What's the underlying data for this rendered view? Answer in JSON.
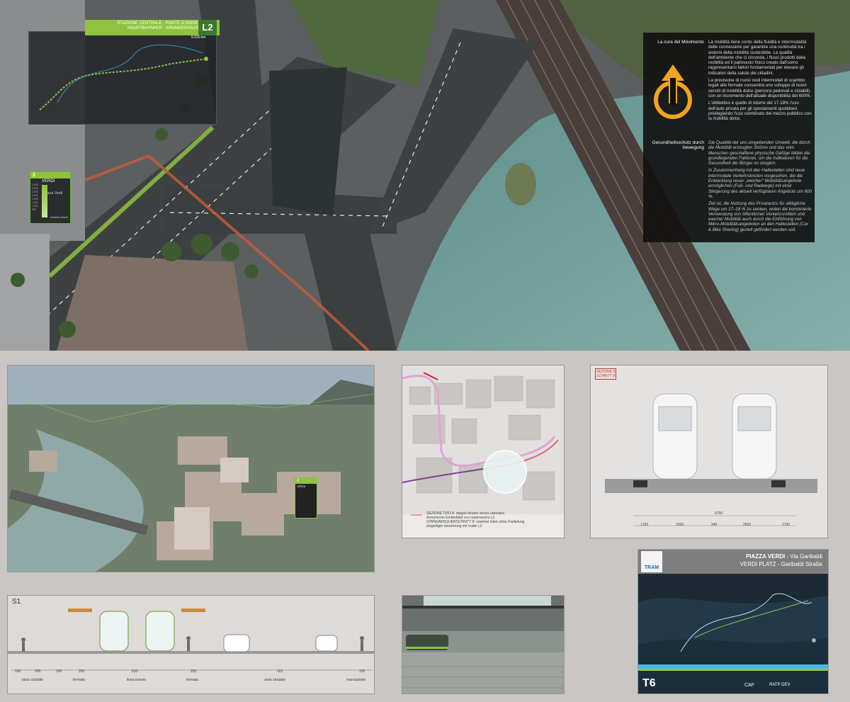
{
  "minimap": {
    "station": "STAZIONE CENTRALE : PONTE D'ADIGE",
    "station_de": "HAUPTBAHNHOF : KRANKENHAUS",
    "line": "L2",
    "distance": "5.020 km"
  },
  "stop_sign": {
    "line": "2",
    "name_it": "VERDI",
    "name_small": "piazza Verdi",
    "scale": [
      "4.000",
      "3.500",
      "3.000",
      "2.500",
      "2.000",
      "1.500",
      "1.000",
      "500"
    ],
    "legend": [
      "residenti",
      "addetti"
    ]
  },
  "text_panel": {
    "heading_it": "La cura del Movimento",
    "body_it_1": "La mobilità tiene conto della fluidità e intermodalità delle connessioni per garantire una continuità tra i sistemi della mobilità sostenibile. La qualità dell'ambiente che ci circonda, i flussi prodotti dalla mobilità ed il palinsesto fisico creato dall'uomo rappresentano fattori fondamentali per elevare gli indicatori della salute dei cittadini.",
    "body_it_2": "La previsione di nuovi nodi intermodali di scambio legati alle fermate consentirà uno sviluppo di nuovi servizi di mobilità dolce (percorsi pedonali e ciclabili) con un incremento dell'attuale disponibilità del 600%.",
    "body_it_3": "L'obbiettivo è quello di ridurre del 17-18% l'uso dell'auto privata per gli spostamenti quotidiani privilegiando l'uso combinato del mezzo pubblico con la mobilità dolce.",
    "heading_de": "Gesundheitsschutz durch bewegung",
    "body_de_1": "Die Qualität der uns umgebenden Umwelt, die durch die Mobilität erzeugten Ströme und das vom Menschen geschaffene physische Gefüge bilden die grundlegenden Faktoren, um die Indikatoren für die Gesundheit der Bürger zu steigern.",
    "body_de_2": "In Zusammenhang mit den Haltestellen sind neue intermodale Verkehrsknoten vorgesehen, die die Entwicklung neuer „weicher“ Mobilitätsangebote ermöglichen (Fuß- und Radwege) mit einer Steigerung des aktuell verfügbaren Angebots um 600 %.",
    "body_de_3": "Ziel ist, die Nutzung des Privatautos für alltägliche Wege um 17–18 % zu senken, wobei die kombinierte Verwendung von öffentlichen Verkehrsmitteln und weicher Mobilität auch durch die Einführung von Mikro-Mobilitätsangeboten an den Haltestellen (Car & Bike Sharing) gezielt gefördert werden soll."
  },
  "photo_sign": {
    "line": "2",
    "name": "VERDI"
  },
  "plan": {
    "legend_1": "SEZIONE TIPO 8: doppio binario senza catenaria",
    "legend_2": "Armamento Embedded con materassino L2",
    "legend_3": "STANDARDQUERSCHNITT 8: zweimal Gleis ohne Freileitung",
    "legend_4": "eingefügte bewehrung mit matte L2"
  },
  "section": {
    "tag_1": "SEZIONE 8",
    "tag_2": "SCHNITT 8",
    "dim_total": "6750",
    "dims": [
      "1700",
      "2500",
      "340",
      "2500",
      "1700"
    ]
  },
  "s1": {
    "label": "S1",
    "dims": [
      "100",
      "200",
      "100",
      "250",
      "610",
      "250",
      "115",
      "150"
    ],
    "zones": [
      "pista ciclabile",
      "fermata",
      "linea tranvia",
      "fermata",
      "sede stradale",
      "marciapiede"
    ]
  },
  "t6": {
    "title": "PIAZZA VERDI",
    "title_sub": " - Via Garibaldi",
    "title_de": "VERDI PLATZ",
    "title_de_sub": " - Garibaldi Straße",
    "code": "T6",
    "logo": "TRAM",
    "brands": [
      "CAF",
      "RATP DEV"
    ]
  },
  "colors": {
    "green": "#8fc23f",
    "dark_green": "#3d7a2c",
    "accent": "#f2a51a",
    "track_red": "#c25a3c"
  }
}
